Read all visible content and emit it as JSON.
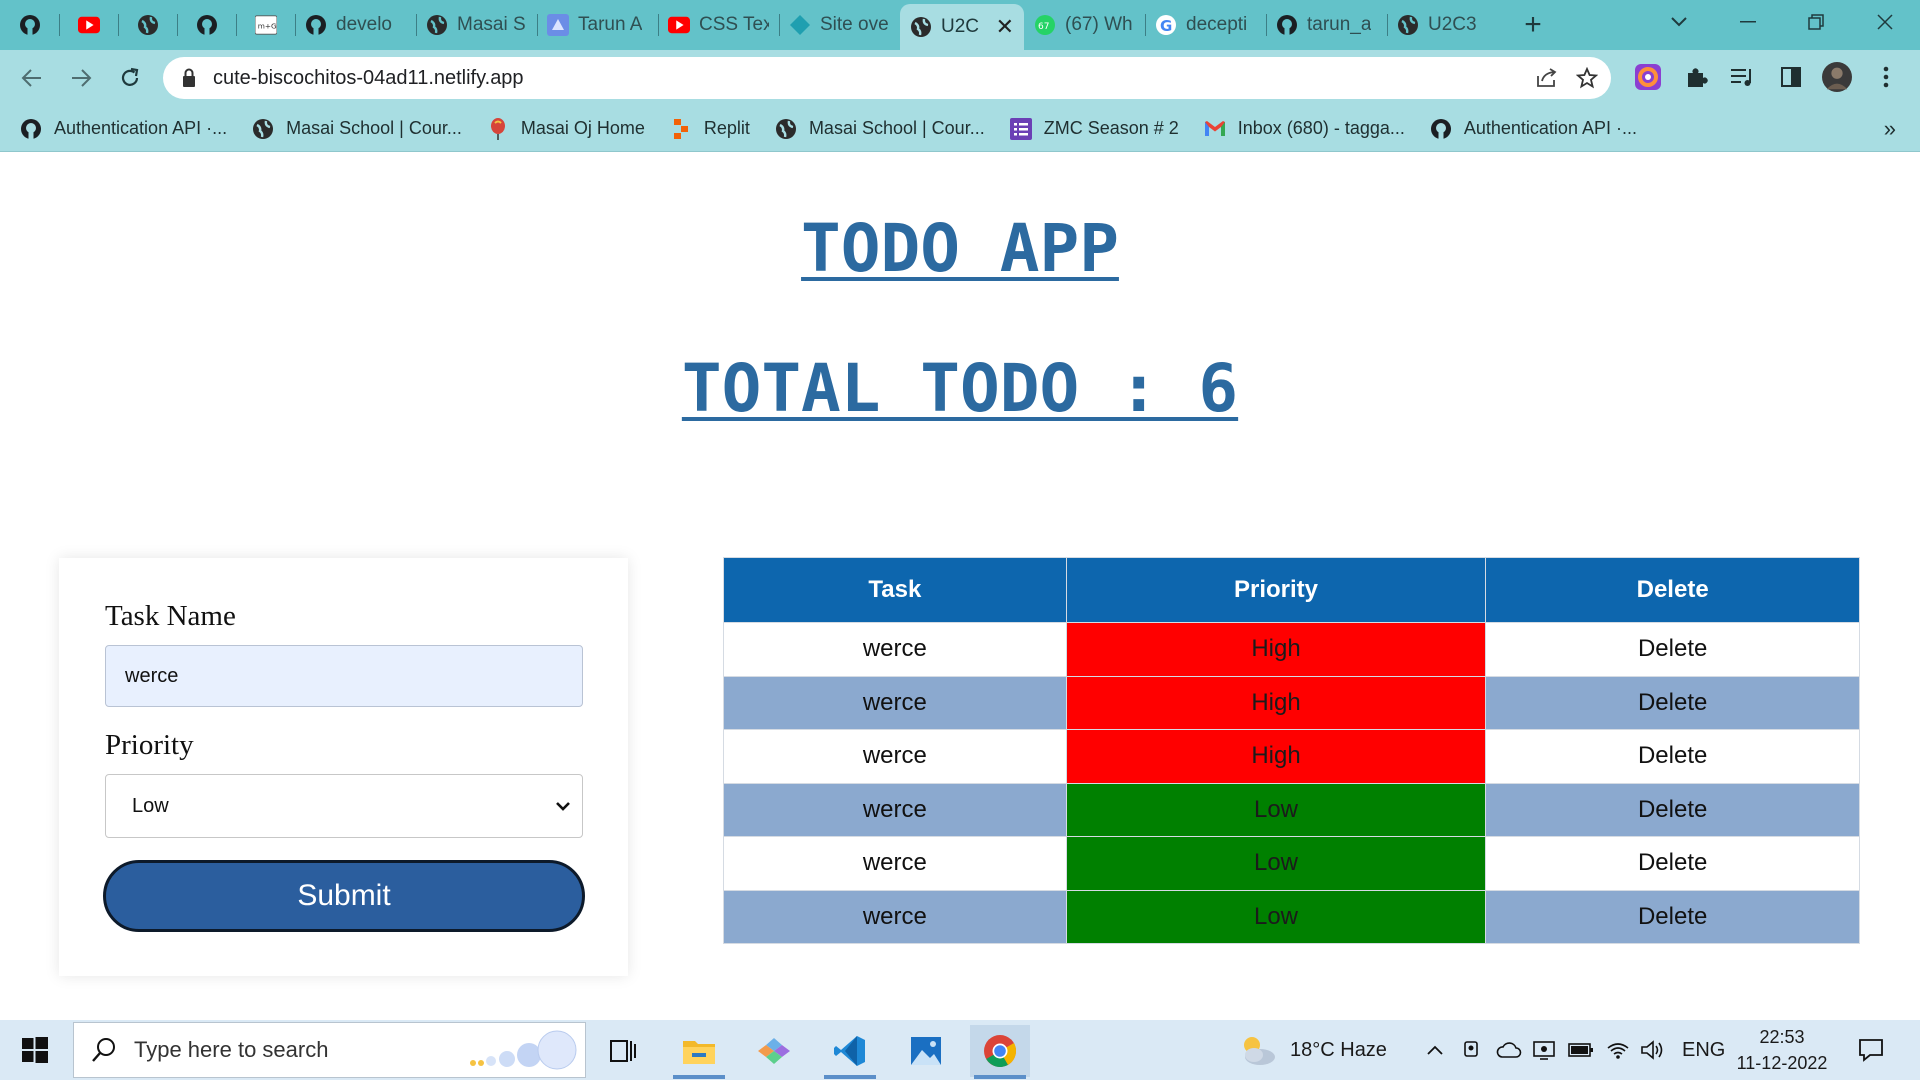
{
  "browser": {
    "tabs": [
      {
        "icon": "github-icon",
        "title": ""
      },
      {
        "icon": "youtube-icon",
        "title": ""
      },
      {
        "icon": "globe-icon",
        "title": ""
      },
      {
        "icon": "github-icon",
        "title": ""
      },
      {
        "icon": "mcg-icon",
        "title": ""
      },
      {
        "icon": "github-icon",
        "title": "develo"
      },
      {
        "icon": "globe-icon",
        "title": "Masai S"
      },
      {
        "icon": "tarun-icon",
        "title": "Tarun A"
      },
      {
        "icon": "youtube-icon",
        "title": "CSS Tex"
      },
      {
        "icon": "netlify-icon",
        "title": "Site ove"
      },
      {
        "icon": "globe-icon",
        "title": "U2C",
        "active": true
      },
      {
        "icon": "whatsapp-icon",
        "title": "(67) Wh"
      },
      {
        "icon": "google-icon",
        "title": "decepti"
      },
      {
        "icon": "github-icon",
        "title": "tarun_a"
      },
      {
        "icon": "globe-icon",
        "title": "U2C3"
      }
    ],
    "url": "cute-biscochitos-04ad11.netlify.app",
    "bookmarks": [
      {
        "icon": "github-icon",
        "label": "Authentication API ·..."
      },
      {
        "icon": "globe-icon",
        "label": "Masai School | Cour..."
      },
      {
        "icon": "balloon-icon",
        "label": "Masai Oj Home"
      },
      {
        "icon": "replit-icon",
        "label": "Replit"
      },
      {
        "icon": "globe-icon",
        "label": "Masai School | Cour..."
      },
      {
        "icon": "list-icon",
        "label": "ZMC Season # 2"
      },
      {
        "icon": "gmail-icon",
        "label": "Inbox (680) - tagga..."
      },
      {
        "icon": "github-icon",
        "label": "Authentication API ·..."
      }
    ],
    "bookmarks_more": "»"
  },
  "page": {
    "title": "TODO APP",
    "total_text": "TOTAL TODO : 6",
    "form": {
      "task_label": "Task Name",
      "task_value": "werce",
      "priority_label": "Priority",
      "priority_selected": "Low",
      "submit_label": "Submit"
    },
    "table": {
      "headers": [
        "Task",
        "Priority",
        "Delete"
      ],
      "rows": [
        {
          "task": "werce",
          "priority": "High",
          "delete": "Delete"
        },
        {
          "task": "werce",
          "priority": "High",
          "delete": "Delete"
        },
        {
          "task": "werce",
          "priority": "High",
          "delete": "Delete"
        },
        {
          "task": "werce",
          "priority": "Low",
          "delete": "Delete"
        },
        {
          "task": "werce",
          "priority": "Low",
          "delete": "Delete"
        },
        {
          "task": "werce",
          "priority": "Low",
          "delete": "Delete"
        }
      ]
    },
    "colors": {
      "heading": "#2c6aa0",
      "table_header": "#0d66ae",
      "row_alt": "#8ba9cf",
      "priority_high": "#ff0000",
      "priority_low": "#008000",
      "submit_bg": "#2b5e9e"
    }
  },
  "taskbar": {
    "search_placeholder": "Type here to search",
    "weather": "18°C  Haze",
    "language": "ENG",
    "time": "22:53",
    "date": "11-12-2022"
  }
}
